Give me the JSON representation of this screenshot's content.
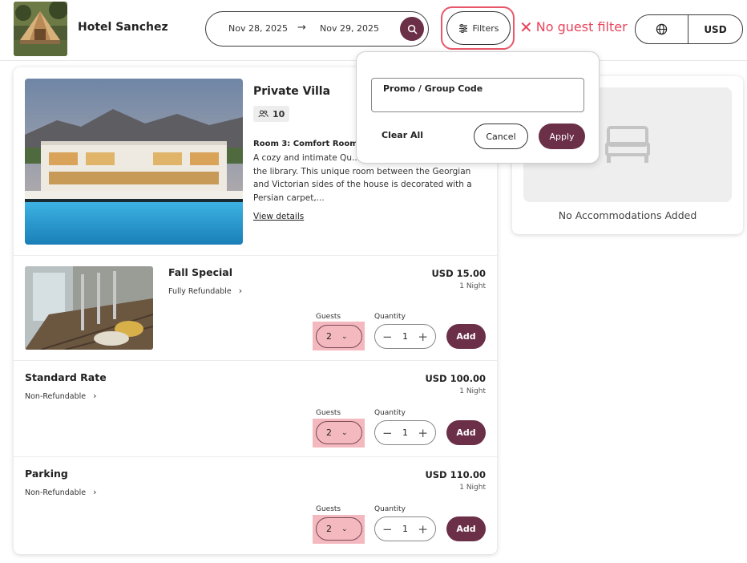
{
  "header": {
    "hotel_name": "Hotel Sanchez",
    "check_in": "Nov 28, 2025",
    "arrow": "→",
    "check_out": "Nov 29, 2025",
    "filters_label": "Filters",
    "currency": "USD"
  },
  "annotation": {
    "mark": "✕",
    "text": "No guest filter"
  },
  "filters_popover": {
    "promo_label": "Promo / Group Code",
    "promo_value": "",
    "clear_all": "Clear All",
    "cancel": "Cancel",
    "apply": "Apply"
  },
  "room": {
    "title": "Private Villa",
    "capacity": "10",
    "subtitle": "Room 3: Comfort Room",
    "description": "A cozy and intimate Qu... with a gas fireplace above the library. This unique room between the Georgian and Victorian sides of the house is decorated with a Persian carpet,...",
    "view_details": "View details"
  },
  "rates": [
    {
      "title": "Fall Special",
      "policy": "Fully Refundable",
      "price": "USD 15.00",
      "nights": "1 Night",
      "guests_label": "Guests",
      "guests": "2",
      "quantity_label": "Quantity",
      "quantity": "1",
      "add_label": "Add"
    },
    {
      "title": "Standard Rate",
      "policy": "Non-Refundable",
      "price": "USD 100.00",
      "nights": "1 Night",
      "guests_label": "Guests",
      "guests": "2",
      "quantity_label": "Quantity",
      "quantity": "1",
      "add_label": "Add"
    },
    {
      "title": "Parking",
      "policy": "Non-Refundable",
      "price": "USD 110.00",
      "nights": "1 Night",
      "guests_label": "Guests",
      "guests": "2",
      "quantity_label": "Quantity",
      "quantity": "1",
      "add_label": "Add"
    }
  ],
  "sidebar": {
    "empty_label": "No Accommodations Added"
  },
  "colors": {
    "brand": "#6b2f47",
    "annotation": "#e8435a",
    "guest_highlight": "#f4b8bf"
  },
  "icons": {
    "search": "search-icon",
    "filters": "sliders-icon",
    "globe": "globe-icon",
    "guests": "users-icon",
    "chevron": "chevron-right-icon",
    "dropdown": "chevron-down-icon",
    "bed": "bed-icon"
  }
}
